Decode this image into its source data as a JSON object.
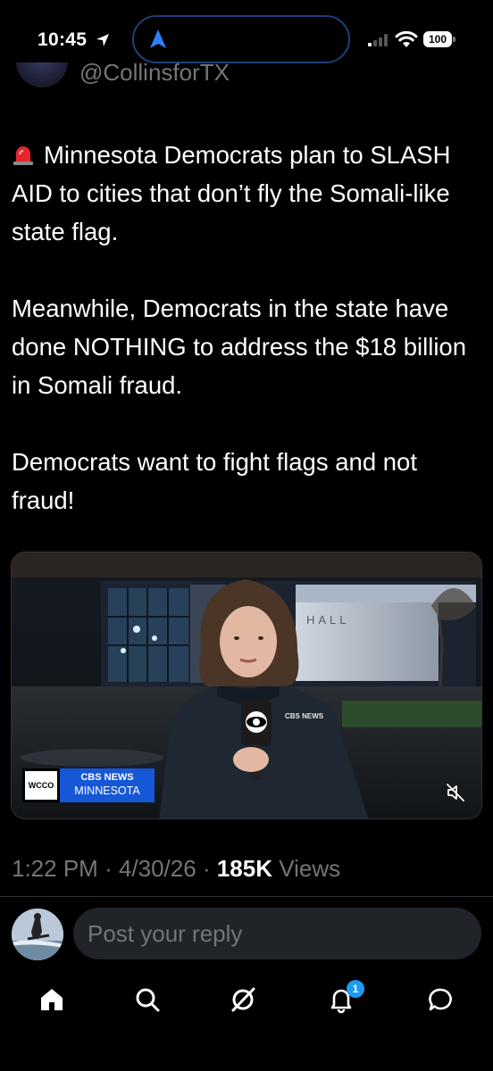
{
  "status_bar": {
    "time": "10:45",
    "battery": "100",
    "icons": [
      "location-arrow-icon",
      "navigation-icon",
      "signal-icon",
      "wifi-icon",
      "battery-icon"
    ]
  },
  "tweet": {
    "author_handle": "@CollinsforTX",
    "paragraphs": [
      "Minnesota Democrats plan to SLASH AID to cities that don’t fly the Somali-like state flag.",
      "Meanwhile, Democrats in the state have done NOTHING to address the $18 billion in Somali fraud.",
      "Democrats want to fight flags and not fraud!"
    ],
    "lead_emoji": "siren-icon",
    "video": {
      "station_logo": "WCCO",
      "network_line1": "CBS NEWS",
      "network_line2": "MINNESOTA",
      "mic_flag": "CBS NEWS",
      "building_sign": "HALL",
      "muted": true
    },
    "time": "1:22 PM",
    "date": "4/30/26",
    "views_count": "185K",
    "views_label": "Views"
  },
  "reply": {
    "placeholder": "Post your reply"
  },
  "bottom_nav": {
    "items": [
      "home",
      "search",
      "grok",
      "notifications",
      "messages"
    ],
    "notification_count": "1"
  },
  "colors": {
    "background": "#000000",
    "text": "#ffffff",
    "secondary_text": "#71767b",
    "accent": "#1d9bf0",
    "cbs_blue": "#1657d8"
  }
}
